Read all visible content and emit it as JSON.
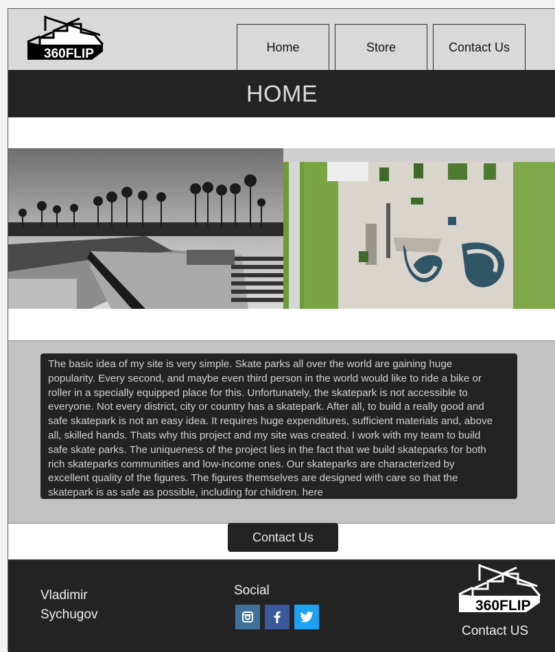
{
  "brand": {
    "logo_text": "360FLIP"
  },
  "nav": {
    "home": "Home",
    "store": "Store",
    "contact": "Contact Us"
  },
  "page": {
    "title": "HOME"
  },
  "about": {
    "lines": [
      "The basic idea of my site is very simple. Skate parks all over the world are gaining huge",
      "popularity. Every second, and maybe even third person in the world would like to ride a bike or",
      "roller in a specially equipped place for this. Unfortunately, the skatepark is not accessible to",
      "everyone. Not every district, city or country has a skatepark. After all, to build a really good and",
      "safe skatepark is not an easy idea. It requires huge expenditures, sufficient materials and, above",
      "all, skilled hands. Thats why this project and my site was created. I work with my team to build",
      "safe skate parks. The uniqueness of the project lies in the fact that we build skateparks for both",
      "rich skateparks communities and low-income ones. Our skateparks are characterized by",
      "excellent quality of the figures. The figures themselves are designed with care so that the",
      "skatepark is as safe as possible, including for children. here"
    ]
  },
  "contact_button": "Contact Us",
  "footer": {
    "author_first": "Vladimir",
    "author_last": "Sychugov",
    "social_label": "Social",
    "social_icons": [
      "instagram-icon",
      "facebook-icon",
      "twitter-icon"
    ],
    "contact_link": "Contact US"
  },
  "colors": {
    "header_bg": "#d9d9d9",
    "dark": "#232323",
    "about_bg": "#c2c2c2",
    "instagram": "#3f729b",
    "facebook": "#3b5998",
    "twitter": "#1da1f2"
  }
}
